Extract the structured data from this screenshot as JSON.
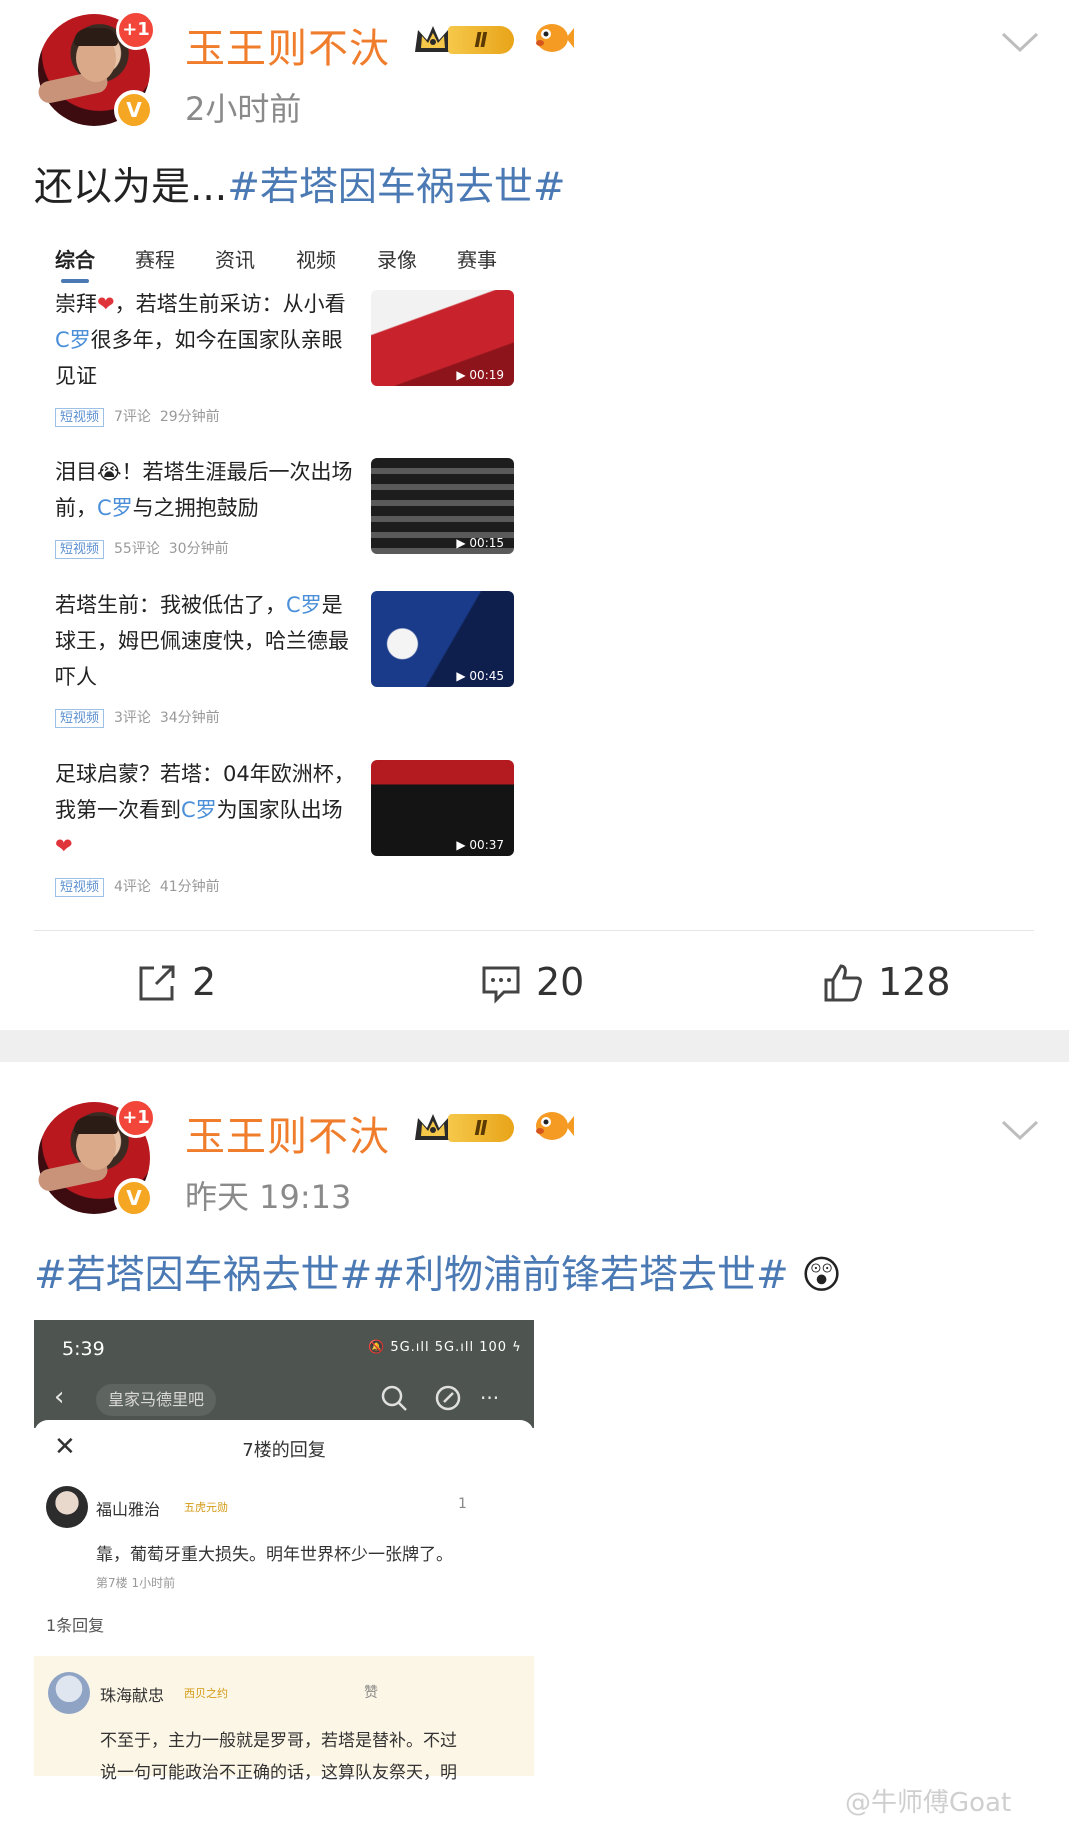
{
  "post1": {
    "username": "玉王则不汏",
    "level": "Ⅱ",
    "plus_badge": "+1",
    "verified_badge": "V",
    "time": "2小时前",
    "text_prefix": "还以为是...",
    "text_topic": "#若塔因车祸去世#",
    "card": {
      "tabs": [
        "综合",
        "赛程",
        "资讯",
        "视频",
        "录像",
        "赛事"
      ],
      "active_tab": "综合",
      "items": [
        {
          "title_parts": [
            "崇拜",
            "❤",
            "，若塔生前采访：从小看",
            "C罗",
            "很多年，如今在国家队亲眼见证"
          ],
          "tag": "短视频",
          "comments": "7评论",
          "time": "29分钟前",
          "duration": "▶ 00:19"
        },
        {
          "title_parts": [
            "泪目",
            "😭",
            "！若塔生涯最后一次出场前，",
            "C罗",
            "与之拥抱鼓励"
          ],
          "tag": "短视频",
          "comments": "55评论",
          "time": "30分钟前",
          "duration": "▶ 00:15"
        },
        {
          "title_parts": [
            "若塔生前：我被低估了，",
            "C罗",
            "是球王，姆巴佩速度快，哈兰德最吓人"
          ],
          "tag": "短视频",
          "comments": "3评论",
          "time": "34分钟前",
          "duration": "▶ 00:45"
        },
        {
          "title_parts": [
            "足球启蒙？若塔：04年欧洲杯，我第一次看到",
            "C罗",
            "为国家队出场",
            "❤"
          ],
          "tag": "短视频",
          "comments": "4评论",
          "time": "41分钟前",
          "duration": "▶ 00:37"
        }
      ]
    },
    "actions": {
      "share": "2",
      "comment": "20",
      "like": "128"
    }
  },
  "post2": {
    "username": "玉王则不汏",
    "level": "Ⅱ",
    "plus_badge": "+1",
    "verified_badge": "V",
    "time": "昨天 19:13",
    "topic1": "#若塔因车祸去世#",
    "topic2": "#利物浦前锋若塔去世#",
    "emoji": "😲",
    "screenshot": {
      "time": "5:39",
      "status_icons": "🔕 5G.ıll 5G.ıll 100 ϟ",
      "battery": "100",
      "forum_name": "皇家马德里吧",
      "back": "‹",
      "more": "···",
      "sheet_title": "7楼的回复",
      "close": "✕",
      "comment": {
        "user": "福山雅治",
        "badge": "五虎元勋",
        "likes": "1",
        "text": "靠，葡萄牙重大损失。明年世界杯少一张牌了。",
        "meta": "第7楼  1小时前"
      },
      "reply_count": "1条回复",
      "reply": {
        "user": "珠海献忠",
        "badge": "西贝之约",
        "like_label": "赞",
        "line1": "不至于，主力一般就是罗哥，若塔是替补。不过",
        "line2": "说一句可能政治不正确的话，这算队友祭天，明"
      }
    }
  },
  "watermark": "@牛师傅Goat"
}
